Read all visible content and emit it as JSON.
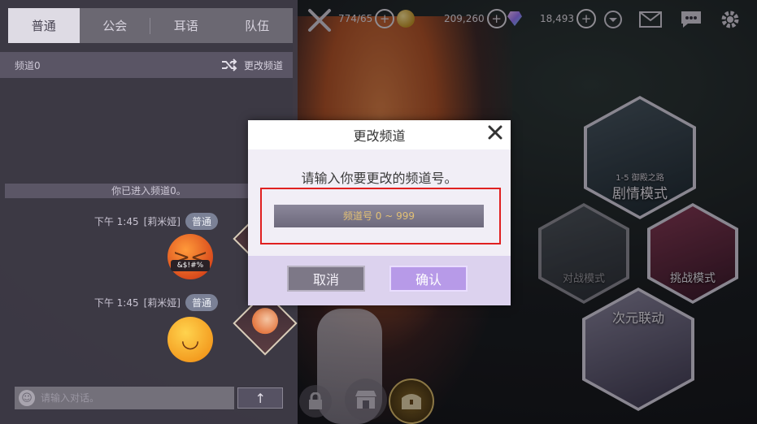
{
  "chat": {
    "tabs": [
      "普通",
      "公会",
      "耳语",
      "队伍"
    ],
    "active_tab": "普通",
    "channel": "频道0",
    "change_channel_label": "更改频道",
    "system_message": "你已进入频道0。",
    "messages": [
      {
        "time": "下午 1:45",
        "sender": "[莉米娅]",
        "badge": "普通",
        "emoji": "angry-emoji",
        "emoji_text": "&$!#%"
      },
      {
        "time": "下午 1:45",
        "sender": "[莉米娅]",
        "badge": "普通",
        "emoji": "hug-emoji"
      }
    ],
    "input_placeholder": "请输入对话。"
  },
  "topbar": {
    "stamina": "774/65",
    "gold": "209,260",
    "gems": "18,493"
  },
  "menu": {
    "story_sub": "1-5 御殿之路",
    "story": "剧情模式",
    "battle": "对战模式",
    "challenge": "挑战模式",
    "collab": "次元联动"
  },
  "modal": {
    "title": "更改频道",
    "prompt": "请输入你要更改的频道号。",
    "input_placeholder": "频道号 0 ~ 999",
    "cancel": "取消",
    "confirm": "确认"
  },
  "colors": {
    "highlight_border": "#e02020",
    "confirm_button": "#b79ae8",
    "cancel_button": "#7d7887",
    "input_text": "#e2c075"
  }
}
